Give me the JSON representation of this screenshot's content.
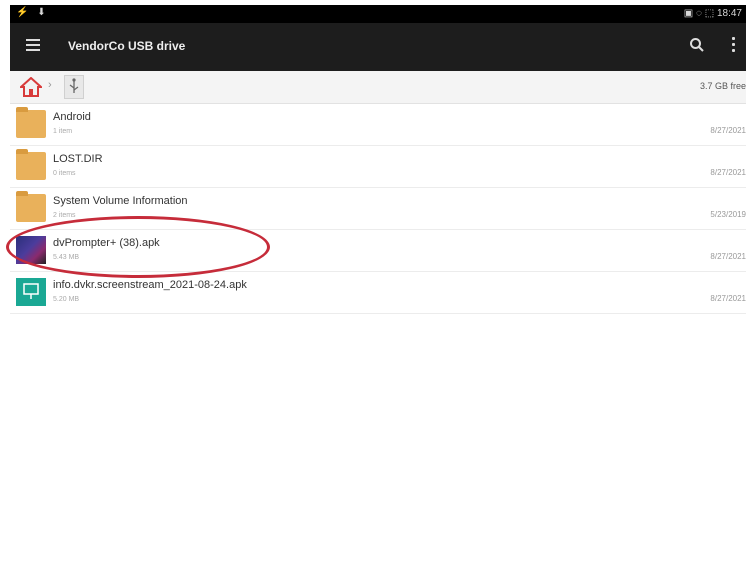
{
  "status_bar": {
    "left": "⚡ ⬇",
    "right": "▣ ◌ ⬚  18:47"
  },
  "app_bar": {
    "title": "VendorCo USB drive"
  },
  "breadcrumb": {
    "free_space": "3.7 GB free"
  },
  "files": [
    {
      "name": "Android",
      "meta": "1 item",
      "date": "8/27/2021",
      "icon": "folder-icon"
    },
    {
      "name": "LOST.DIR",
      "meta": "0 items",
      "date": "8/27/2021",
      "icon": "folder-icon"
    },
    {
      "name": "System Volume Information",
      "meta": "2 items",
      "date": "5/23/2019",
      "icon": "folder-icon"
    },
    {
      "name": "dvPrompter+ (38).apk",
      "meta": "5.43 MB",
      "date": "8/27/2021",
      "icon": "apk-icon"
    },
    {
      "name": "info.dvkr.screenstream_2021-08-24.apk",
      "meta": "5.20 MB",
      "date": "8/27/2021",
      "icon": "apk-icon"
    }
  ],
  "colors": {
    "app_bar": "#1d1d1d",
    "folder": "#e9b15b",
    "highlight": "#c62c3a"
  }
}
